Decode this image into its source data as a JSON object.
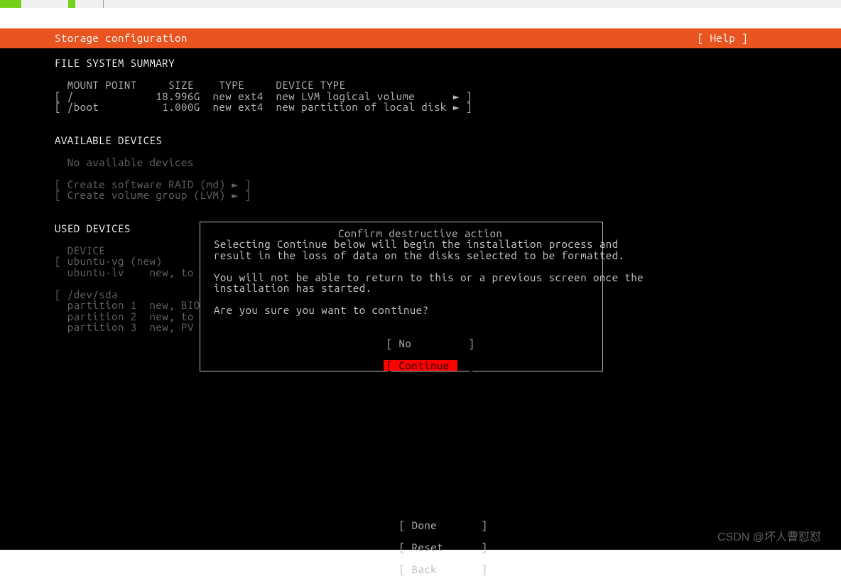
{
  "header": {
    "title": "Storage configuration",
    "help": "[ Help ]"
  },
  "fs_summary": {
    "heading": "FILE SYSTEM SUMMARY",
    "cols": "  MOUNT POINT     SIZE    TYPE     DEVICE TYPE",
    "row1": "[ /             18.996G  new ext4  new LVM logical volume      ► ]",
    "row2": "[ /boot          1.000G  new ext4  new partition of local disk ► ]"
  },
  "avail": {
    "heading": "AVAILABLE DEVICES",
    "none": "  No available devices",
    "raid": "[ Create software RAID (md) ► ]",
    "lvm": "[ Create volume group (LVM) ► ]"
  },
  "used": {
    "heading": "USED DEVICES",
    "device_label": "  DEVICE",
    "vg": "[ ubuntu-vg (new)",
    "lv": "  ubuntu-lv    new, to",
    "sda": "[ /dev/sda",
    "p1": "  partition 1  new, BIO",
    "p2": "  partition 2  new, to ",
    "p3": "  partition 3  new, PV "
  },
  "dialog": {
    "title": "Confirm destructive action",
    "body": "Selecting Continue below will begin the installation process and\nresult in the loss of data on the disks selected to be formatted.\n\nYou will not be able to return to this or a previous screen once the\ninstallation has started.\n\nAre you sure you want to continue?",
    "no_label": "[ No         ]",
    "continue_label": "[ Continue   ]"
  },
  "bottom": {
    "done": "[ Done       ]",
    "reset": "[ Reset      ]",
    "back": "[ Back       ]"
  },
  "watermark": "CSDN @坏人曹怼怼"
}
